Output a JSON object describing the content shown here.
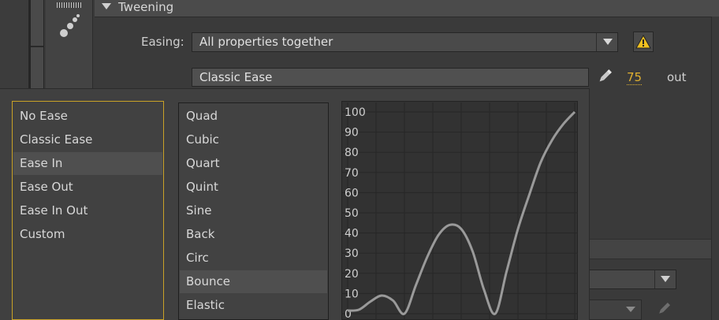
{
  "header": {
    "title": "Tweening"
  },
  "easing": {
    "label": "Easing:",
    "selected": "All properties together"
  },
  "ease": {
    "preset": "Classic Ease",
    "amount": "75",
    "direction": "out"
  },
  "popup": {
    "ease_types": [
      "No Ease",
      "Classic Ease",
      "Ease In",
      "Ease Out",
      "Ease In Out",
      "Custom"
    ],
    "selected_type": "Ease In",
    "functions": [
      "Quad",
      "Cubic",
      "Quart",
      "Quint",
      "Sine",
      "Back",
      "Circ",
      "Bounce",
      "Elastic"
    ],
    "selected_function": "Bounce"
  },
  "colors": {
    "accent": "#e0b030",
    "selection_border": "#c9a227",
    "curve": "#9a9a9a",
    "warning": "#f0c020"
  },
  "icons": [
    "ease-preset-icon",
    "warning-icon",
    "pencil-icon",
    "chevron-down-icon",
    "disclosure-triangle-icon"
  ],
  "chart_data": {
    "type": "line",
    "title": "",
    "xlabel": "",
    "ylabel": "",
    "ylim": [
      0,
      100
    ],
    "yticks": [
      0,
      10,
      20,
      30,
      40,
      50,
      60,
      70,
      80,
      90,
      100
    ],
    "grid": true,
    "x": [
      0,
      0.05,
      0.1,
      0.15,
      0.2,
      0.25,
      0.3,
      0.35,
      0.4,
      0.45,
      0.5,
      0.55,
      0.6,
      0.65,
      0.7,
      0.75,
      0.8,
      0.85,
      0.9,
      0.95,
      1.0
    ],
    "series": [
      {
        "values": [
          1.5,
          2,
          6,
          9,
          6.5,
          0,
          14,
          28,
          39,
          44,
          42,
          31,
          12,
          0,
          21,
          42,
          59,
          75,
          86,
          94,
          100
        ]
      }
    ]
  }
}
